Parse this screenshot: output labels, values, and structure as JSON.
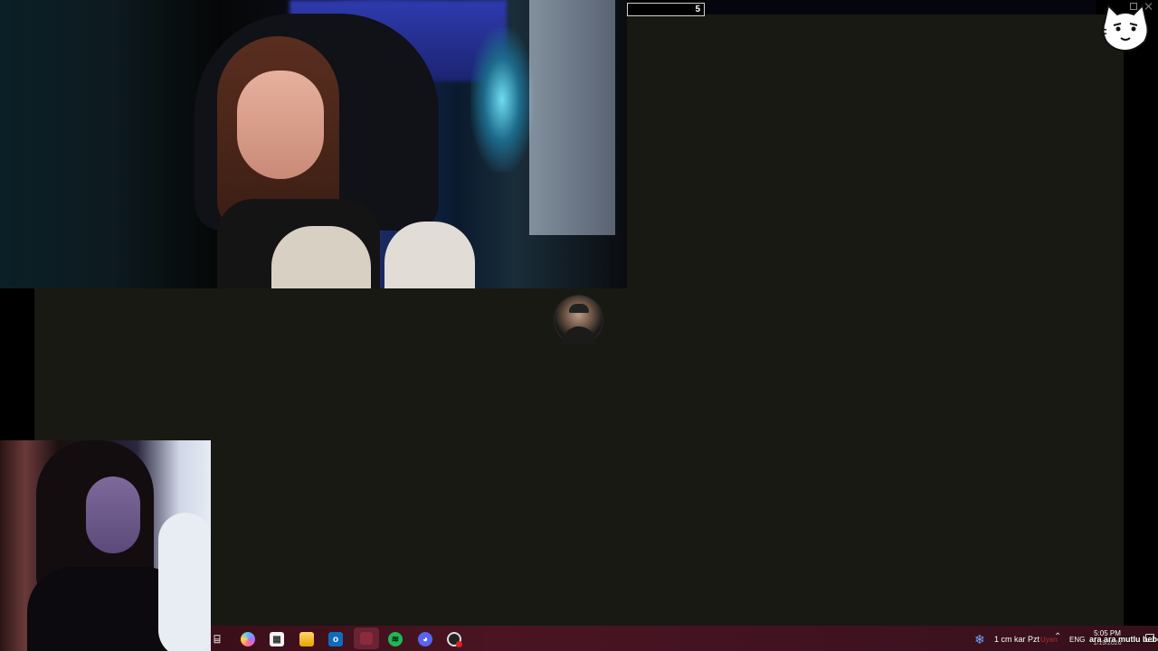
{
  "stream_overlay": {
    "counter_value": "5"
  },
  "taskbar": {
    "apps": [
      {
        "name": "task-view",
        "glyph": "⌸"
      },
      {
        "name": "copilot",
        "glyph": ""
      },
      {
        "name": "microsoft-store",
        "glyph": "▦"
      },
      {
        "name": "file-explorer",
        "glyph": ""
      },
      {
        "name": "outlook",
        "glyph": "o"
      },
      {
        "name": "active-app",
        "glyph": ""
      },
      {
        "name": "spotify",
        "glyph": "≋"
      },
      {
        "name": "discord",
        "glyph": "◕"
      },
      {
        "name": "obs",
        "glyph": ""
      }
    ],
    "weather_text": "1 cm kar Pzt",
    "weather_ticker": "Uyarı",
    "language": "ENG",
    "time": "5:05 PM",
    "date": "1/19/2026",
    "overlay_text": "ara ara mutlu bebek"
  },
  "colors": {
    "taskbar_bg": "#4a1422",
    "canvas_bg": "#181913",
    "weather_icon": "#6fa8ff",
    "brand_spotify": "#1db954",
    "brand_discord": "#5865f2"
  }
}
